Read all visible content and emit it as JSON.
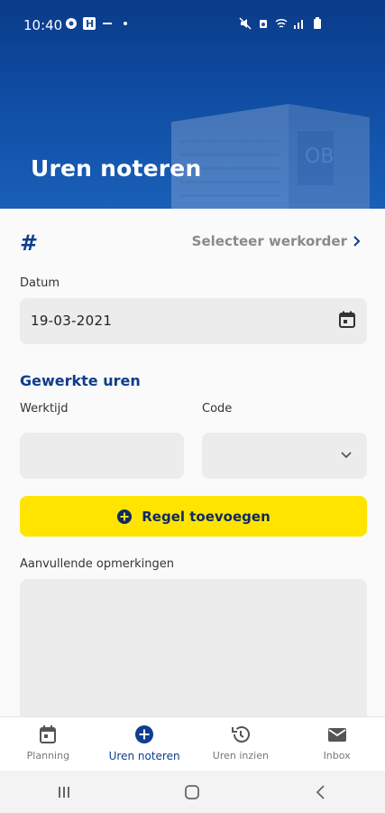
{
  "status_bar": {
    "time": "10:40",
    "left_icons": [
      "soccer-icon",
      "h-badge-icon",
      "dash-icon",
      "dot-icon"
    ],
    "right_icons": [
      "mute-icon",
      "alarm-icon",
      "wifi-icon",
      "signal-icon",
      "battery-icon"
    ]
  },
  "header": {
    "title": "Uren noteren",
    "background_color": "#0f4da3"
  },
  "workorder": {
    "hash": "#",
    "select_label": "Selecteer werkorder"
  },
  "date": {
    "label": "Datum",
    "value": "19-03-2021"
  },
  "worked_hours": {
    "title": "Gewerkte uren",
    "worktime_label": "Werktijd",
    "worktime_value": "",
    "code_label": "Code",
    "code_value": ""
  },
  "add_button": {
    "label": "Regel toevoegen",
    "color": "#ffe400"
  },
  "remarks": {
    "label": "Aanvullende opmerkingen",
    "value": ""
  },
  "bottom_nav": {
    "items": [
      {
        "label": "Planning",
        "icon": "calendar-icon",
        "active": false
      },
      {
        "label": "Uren noteren",
        "icon": "add-circle-icon",
        "active": true
      },
      {
        "label": "Uren inzien",
        "icon": "history-icon",
        "active": false
      },
      {
        "label": "Inbox",
        "icon": "mail-icon",
        "active": false
      }
    ]
  },
  "colors": {
    "primary": "#0f3d8c",
    "accent": "#ffe400"
  }
}
